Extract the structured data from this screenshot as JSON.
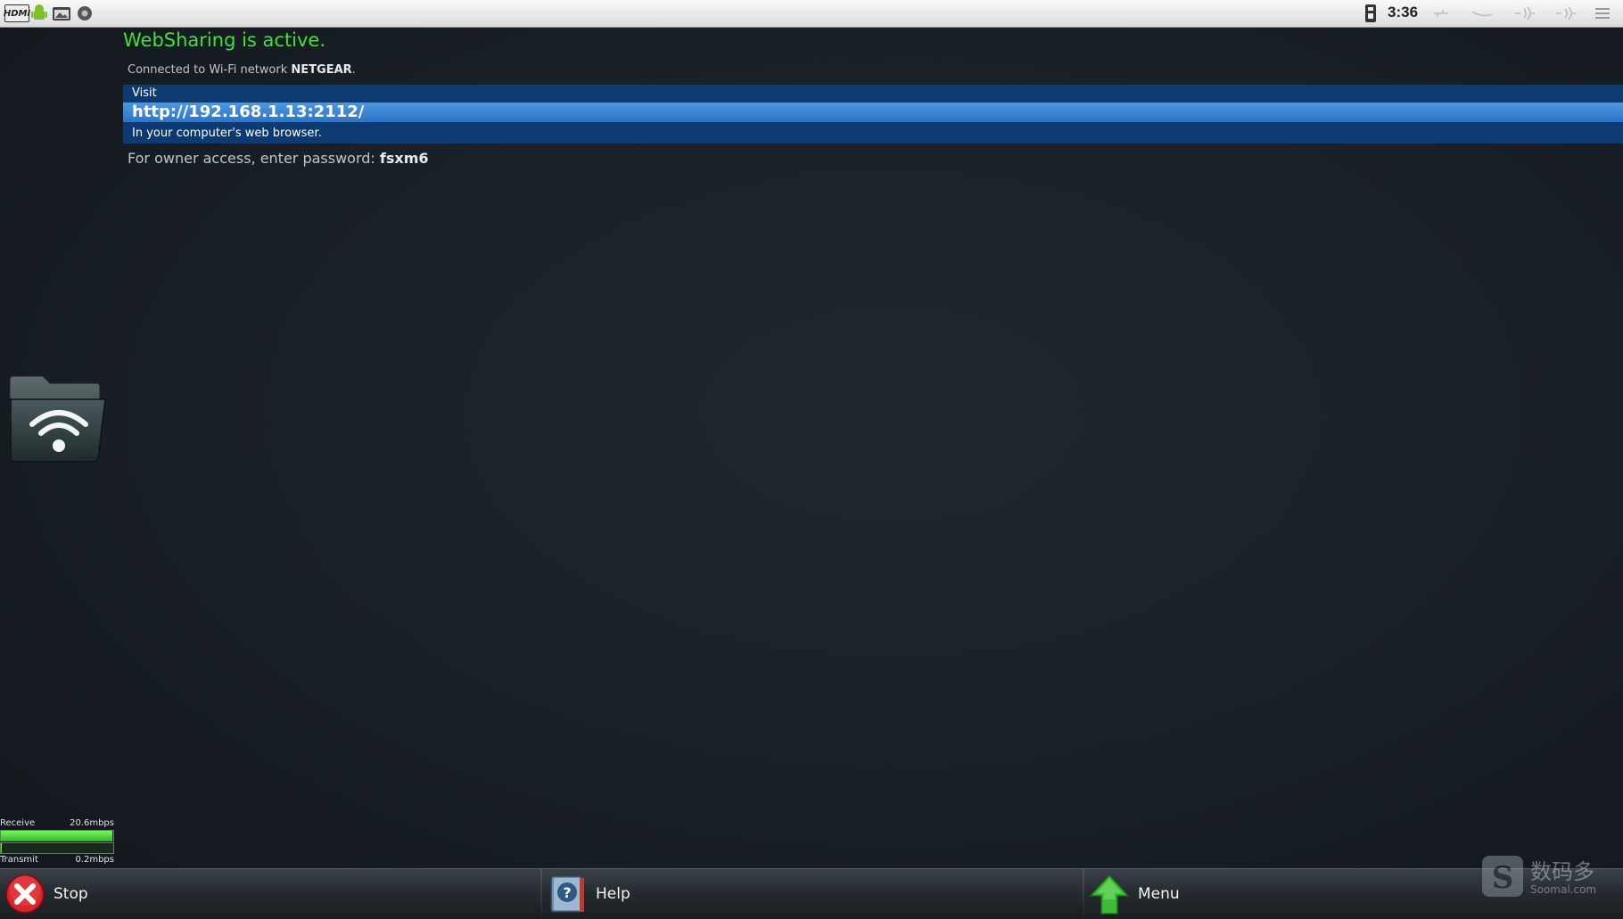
{
  "status_bar": {
    "time": "3:36",
    "left_icons": [
      "hdmi-icon",
      "android-icon",
      "gallery-icon",
      "record-icon"
    ],
    "right_icons": [
      "sim-icon",
      "usb-icon",
      "link-icon",
      "wifi-icon",
      "signal-icon",
      "menu-icon"
    ],
    "hdmi_label": "HDMI"
  },
  "websharing": {
    "status": "WebSharing is active.",
    "network_prefix": "Connected to Wi-Fi network ",
    "network_name": "NETGEAR",
    "network_suffix": ".",
    "visit_label": "Visit",
    "url": "http://192.168.1.13:2112/",
    "browser_note": "In your computer's web browser.",
    "password_prefix": "For owner access, enter password: ",
    "password": "fsxm6"
  },
  "meters": {
    "receive_label": "Receive",
    "receive_value": "20.6mbps",
    "receive_fraction": 0.99,
    "transmit_label": "Transmit",
    "transmit_value": "0.2mbps",
    "transmit_fraction": 0.01
  },
  "bottom_bar": {
    "stop_label": "Stop",
    "help_label": "Help",
    "menu_label": "Menu"
  },
  "watermark": {
    "text": "数码多",
    "subtext": "Soomal.com"
  },
  "colors": {
    "active_green": "#3fe23a",
    "visit_bg": "#0e3a72",
    "url_bar": "#3a84d6"
  }
}
